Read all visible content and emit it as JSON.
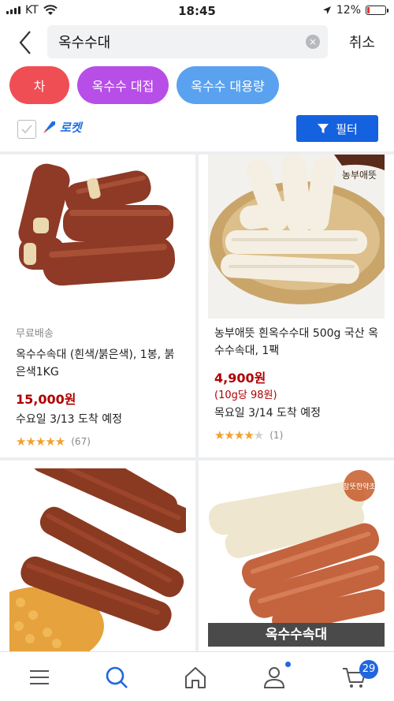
{
  "status": {
    "carrier": "KT",
    "time": "18:45",
    "battery": "12%"
  },
  "search": {
    "query": "옥수수대",
    "clear": "×",
    "cancel": "취소"
  },
  "chips": [
    {
      "label": "차",
      "color": "#ef4e54"
    },
    {
      "label": "옥수수 대접",
      "color": "#b84ee8"
    },
    {
      "label": "옥수수 대용량",
      "color": "#5aa2ef"
    }
  ],
  "rocket_label": "로켓",
  "filter_label": "필터",
  "products": [
    {
      "badge": "무료배송",
      "name": "옥수수속대 (흰색/붉은색), 1봉, 붉은색1KG",
      "price": "15,000원",
      "eta": "수요일 3/13 도착 예정",
      "rating": 4.5,
      "stars": "★★★★★",
      "reviews": "(67)"
    },
    {
      "brand_mark": "농부애뜻",
      "name": "농부애뜻 흰옥수수대 500g 국산 옥수수속대, 1팩",
      "price": "4,900원",
      "unit_price": "(10g당 98원)",
      "eta": "목요일 3/14 도착 예정",
      "rating": 4,
      "stars_filled": "★★★★",
      "stars_empty": "★",
      "reviews": "(1)"
    },
    {
      "image": "red-corn-cobs-with-kernels"
    },
    {
      "image_caption": "옥수수속대",
      "stamp": "참뜻한약초"
    }
  ],
  "tabs": [
    "menu-icon",
    "search-icon",
    "home-icon",
    "user-icon",
    "cart-icon"
  ],
  "cart_count": "29",
  "colors": {
    "accent": "#1462e0",
    "price": "#ae0000",
    "star": "#f3a02a"
  }
}
